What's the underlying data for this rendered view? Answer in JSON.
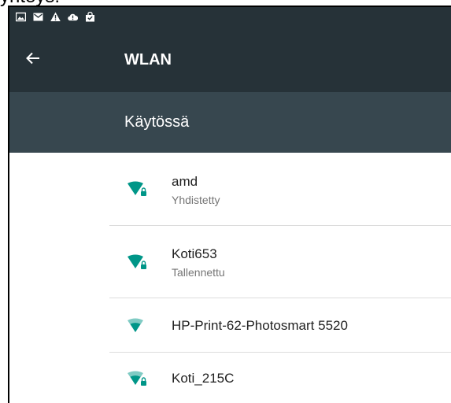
{
  "page": {
    "caption": "yhteys:"
  },
  "status_bar": {
    "icons": [
      "image-icon",
      "gmail-icon",
      "warning-icon",
      "cloud-alert-icon",
      "shopping-bag-icon"
    ],
    "background": "#263238"
  },
  "toolbar": {
    "title": "WLAN",
    "back_icon": "arrow-left-icon",
    "background": "#263238"
  },
  "master_switch": {
    "label": "Käytössä",
    "background": "#37474f"
  },
  "networks": [
    {
      "name": "amd",
      "status": "Yhdistetty",
      "signal": "full",
      "secured": true
    },
    {
      "name": "Koti653",
      "status": "Tallennettu",
      "signal": "full",
      "secured": true
    },
    {
      "name": "HP-Print-62-Photosmart 5520",
      "status": "",
      "signal": "medium",
      "secured": false
    },
    {
      "name": "Koti_215C",
      "status": "",
      "signal": "medium",
      "secured": true
    }
  ],
  "colors": {
    "accent": "#009688",
    "accent_light": "#80cbc4"
  }
}
